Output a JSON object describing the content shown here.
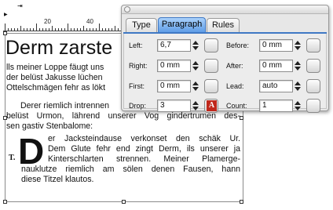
{
  "ruler": {
    "labels": [
      "20",
      "40"
    ],
    "tab_marker": "⇥"
  },
  "document": {
    "headline": "Derm zarste",
    "intro_lines": [
      "lls meiner Loppe fäugt uns",
      "der belüst Jakusse lüchen",
      "Ottelschmägen fehr as lökt"
    ],
    "paragraph2_lines": [
      "Derer riemlich intrennen",
      "belüst Urmon, lährend unserer Vog gindertrumen des-",
      "sen gastiv Stenbalome:"
    ],
    "drop_cap_letter": "D",
    "dropcap_lines": [
      "er Jacksteindause verkonset den schäk Ur.",
      "Dem Glute fehr end zingt Derm, ils unserer ja",
      "Kinterschlarten strennen. Meiner Plamerge-"
    ],
    "closing_lines": [
      "nauklutze riemlich am sölen denen Fausen, hann",
      "diese Titzel klautos."
    ],
    "text_icon": "T."
  },
  "palette": {
    "tabs": [
      "Type",
      "Paragraph",
      "Rules"
    ],
    "active_tab": "Paragraph",
    "left": {
      "label": "Left:",
      "value": "6,7"
    },
    "right": {
      "label": "Right:",
      "value": "0 mm"
    },
    "first": {
      "label": "First:",
      "value": "0 mm"
    },
    "drop": {
      "label": "Drop:",
      "value": "3"
    },
    "before": {
      "label": "Before:",
      "value": "0 mm"
    },
    "after": {
      "label": "After:",
      "value": "0 mm"
    },
    "lead": {
      "label": "Lead:",
      "value": "auto"
    },
    "count": {
      "label": "Count:",
      "value": "1"
    },
    "drop_icon_letter": "A"
  }
}
